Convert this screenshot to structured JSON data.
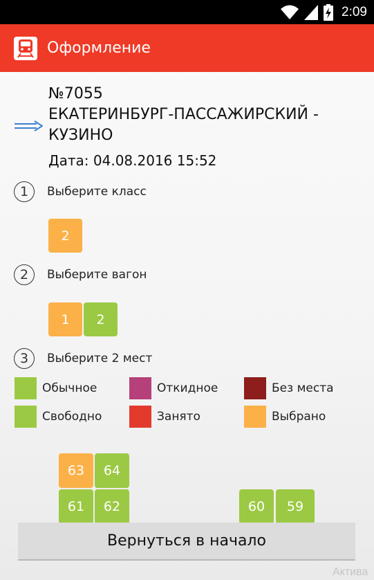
{
  "status_bar": {
    "time": "2:09"
  },
  "app_bar": {
    "title": "Оформление"
  },
  "train": {
    "number": "№7055",
    "route": "ЕКАТЕРИНБУРГ-ПАССАЖИРСКИЙ - КУЗИНО",
    "date": "Дата: 04.08.2016 15:52"
  },
  "steps": [
    {
      "number": "1",
      "label": "Выберите класс"
    },
    {
      "number": "2",
      "label": "Выберите вагон"
    },
    {
      "number": "3",
      "label": "Выберите 2 мест"
    }
  ],
  "classes": [
    {
      "label": "2",
      "state": "selected"
    }
  ],
  "wagons": [
    {
      "label": "1",
      "state": "selected"
    },
    {
      "label": "2",
      "state": "free"
    }
  ],
  "legend": [
    {
      "label": "Обычное",
      "color": "#9bc943"
    },
    {
      "label": "Откидное",
      "color": "#b5407a"
    },
    {
      "label": "Без места",
      "color": "#8d1e1b"
    },
    {
      "label": "Свободно",
      "color": "#9bc943"
    },
    {
      "label": "Занято",
      "color": "#e23b2e"
    },
    {
      "label": "Выбрано",
      "color": "#fbb148"
    }
  ],
  "seats": [
    {
      "label": "63",
      "state": "selected"
    },
    {
      "label": "64",
      "state": "free"
    },
    {
      "label": "61",
      "state": "free"
    },
    {
      "label": "62",
      "state": "free"
    },
    {
      "label": "60",
      "state": "free"
    },
    {
      "label": "59",
      "state": "free"
    }
  ],
  "bottom_button": {
    "label": "Вернуться в начало"
  },
  "watermark": "Актива",
  "colors": {
    "app_bar": "#ee3a27",
    "selected": "#fbb148",
    "free": "#9bc943"
  },
  "icons": {
    "wifi": "wifi-icon",
    "signal": "signal-icon",
    "battery": "battery-charging-icon",
    "logo": "train-icon",
    "route": "long-arrow-right-icon"
  }
}
